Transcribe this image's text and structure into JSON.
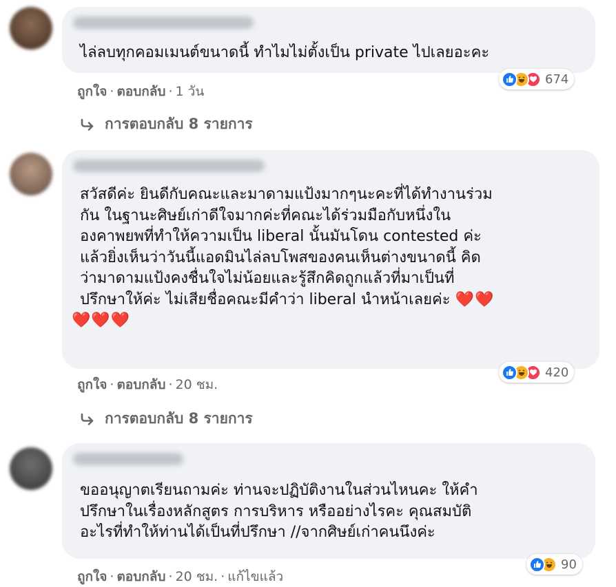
{
  "comments": [
    {
      "lines": [
        "ไล่ลบทุกคอมเมนต์ขนาดนี้ ทำไมไม่ตั้งเป็น private ไปเลยอะคะ"
      ],
      "reaction_count": "674",
      "reactions": [
        "like",
        "haha",
        "love"
      ],
      "like_label": "ถูกใจ",
      "reply_label": "ตอบกลับ",
      "time": "1 วัน",
      "replies_label": "การตอบกลับ 8 รายการ"
    },
    {
      "lines": [
        "สวัสดีค่ะ ยินดีกับคณะและมาดามแป้งมากๆนะคะที่ได้ทำงานร่วม",
        "กัน ในฐานะศิษย์เก่าดีใจมากค่ะที่คณะได้ร่วมมือกับหนึ่งใน",
        "องคาพยพที่ทำให้ความเป็น liberal นั้นมันโดน contested ค่ะ",
        "แล้วยิ่งเห็นว่าวันนี้แอดมินไล่ลบโพสของคนเห็นต่างขนาดนี้ คิด",
        "ว่ามาดามแป้งคงชื่นใจไม่น้อยและรู้สึกคิดถูกแล้วที่มาเป็นที่",
        "ปรึกษาให้ค่ะ ไม่เสียชื่อคณะมีคำว่า liberal นำหน้าเลยค่ะ"
      ],
      "hearts_inline": "❤️❤️",
      "hearts_line": "❤️❤️❤️",
      "reaction_count": "420",
      "reactions": [
        "like",
        "haha",
        "love"
      ],
      "like_label": "ถูกใจ",
      "reply_label": "ตอบกลับ",
      "time": "20 ชม.",
      "replies_label": "การตอบกลับ 8 รายการ"
    },
    {
      "lines": [
        "ขออนุญาตเรียนถามค่ะ ท่านจะปฏิบัติงานในส่วนไหนคะ ให้คำ",
        "ปรึกษาในเรื่องหลักสูตร การบริหาร หรืออย่างไรคะ คุณสมบัติ",
        "อะไรที่ทำให้ท่านได้เป็นที่ปรึกษา //จากศิษย์เก่าคนนึงค่ะ"
      ],
      "reaction_count": "90",
      "reactions": [
        "like",
        "haha"
      ],
      "like_label": "ถูกใจ",
      "reply_label": "ตอบกลับ",
      "time": "20 ชม.",
      "edited_label": "แก้ไขแล้ว"
    }
  ],
  "colors": {
    "bubble": "#f0f2f5",
    "meta_text": "#65676b",
    "like": "#1877f2",
    "haha": "#f7b125",
    "love": "#f33e58"
  },
  "icons": {
    "like": "thumbs-up-icon",
    "haha": "haha-face-icon",
    "love": "heart-icon",
    "reply": "reply-arrow-icon"
  }
}
